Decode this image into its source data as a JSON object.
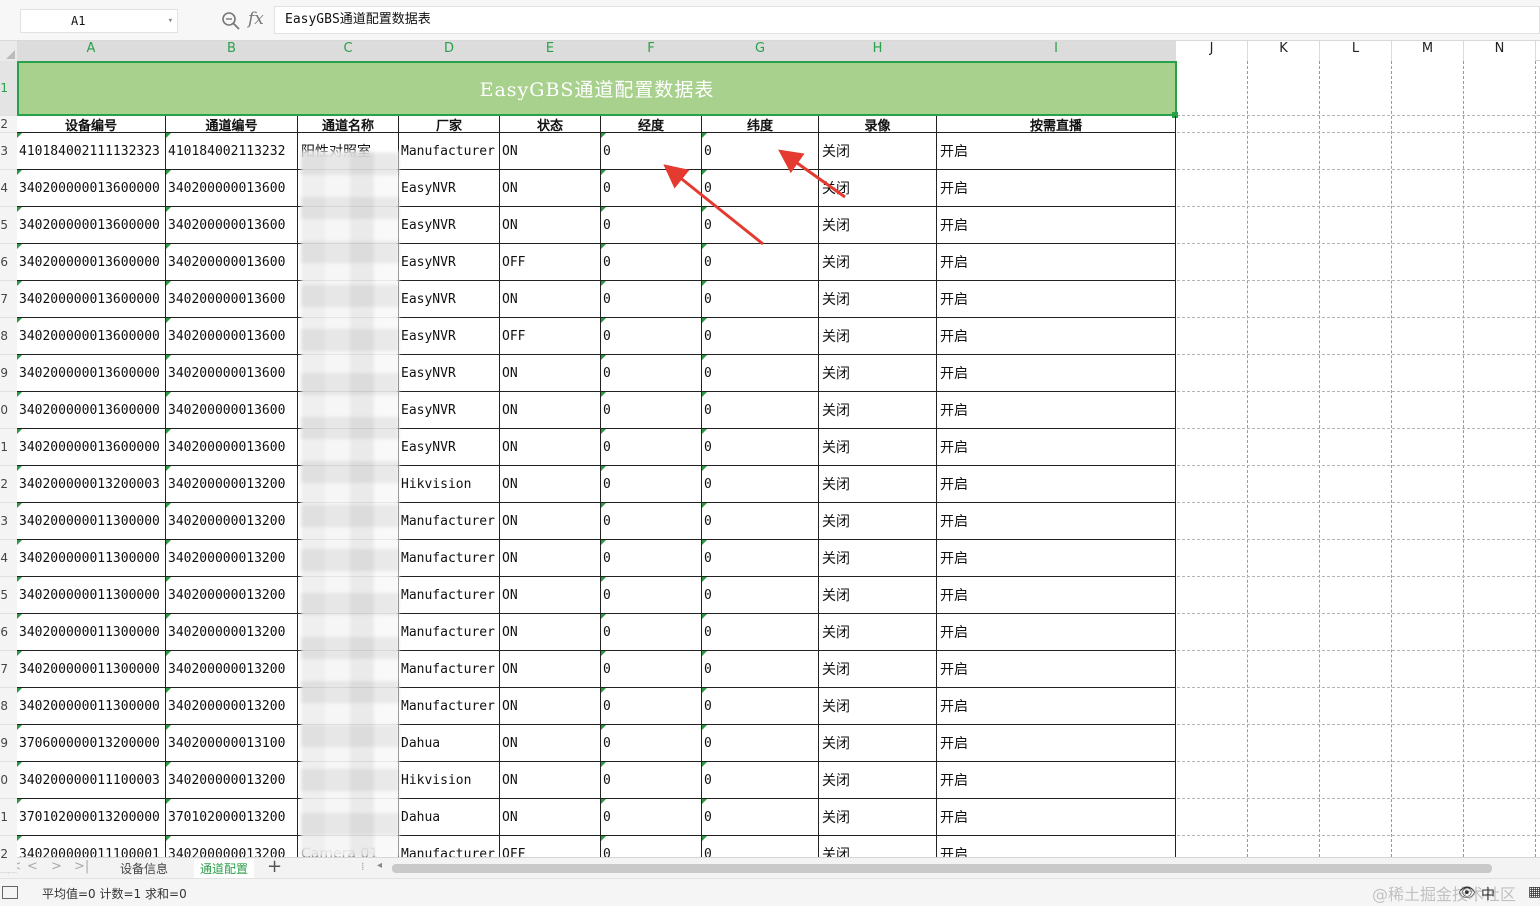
{
  "formula_bar": {
    "cell_ref": "A1",
    "fx_label": "fx",
    "content": "EasyGBS通道配置数据表"
  },
  "columns": [
    "A",
    "B",
    "C",
    "D",
    "E",
    "F",
    "G",
    "H",
    "I",
    "J",
    "K",
    "L",
    "M",
    "N"
  ],
  "row_numbers": [
    "1",
    "2",
    "3",
    "4",
    "5",
    "6",
    "7",
    "8",
    "9",
    "0",
    "1",
    "2",
    "3",
    "4",
    "5",
    "6",
    "7",
    "8",
    "9",
    "0",
    "1",
    "2"
  ],
  "sheet": {
    "title": "EasyGBS通道配置数据表",
    "headers": [
      "设备编号",
      "通道编号",
      "通道名称",
      "厂家",
      "状态",
      "经度",
      "纬度",
      "录像",
      "按需直播"
    ],
    "rows": [
      [
        "410184002111132323",
        "410184002113232",
        "阳性对照室",
        "Manufacturer",
        "ON",
        "0",
        "0",
        "关闭",
        "开启"
      ],
      [
        "340200000013600000",
        "340200000013600",
        "",
        "EasyNVR",
        "ON",
        "0",
        "0",
        "关闭",
        "开启"
      ],
      [
        "340200000013600000",
        "340200000013600",
        "",
        "EasyNVR",
        "ON",
        "0",
        "0",
        "关闭",
        "开启"
      ],
      [
        "340200000013600000",
        "340200000013600",
        "",
        "EasyNVR",
        "OFF",
        "0",
        "0",
        "关闭",
        "开启"
      ],
      [
        "340200000013600000",
        "340200000013600",
        "",
        "EasyNVR",
        "ON",
        "0",
        "0",
        "关闭",
        "开启"
      ],
      [
        "340200000013600000",
        "340200000013600",
        "",
        "EasyNVR",
        "OFF",
        "0",
        "0",
        "关闭",
        "开启"
      ],
      [
        "340200000013600000",
        "340200000013600",
        "",
        "EasyNVR",
        "ON",
        "0",
        "0",
        "关闭",
        "开启"
      ],
      [
        "340200000013600000",
        "340200000013600",
        "",
        "EasyNVR",
        "ON",
        "0",
        "0",
        "关闭",
        "开启"
      ],
      [
        "340200000013600000",
        "340200000013600",
        "",
        "EasyNVR",
        "ON",
        "0",
        "0",
        "关闭",
        "开启"
      ],
      [
        "340200000013200003",
        "340200000013200",
        "",
        "Hikvision",
        "ON",
        "0",
        "0",
        "关闭",
        "开启"
      ],
      [
        "340200000011300000",
        "340200000013200",
        "",
        "Manufacturer",
        "ON",
        "0",
        "0",
        "关闭",
        "开启"
      ],
      [
        "340200000011300000",
        "340200000013200",
        "",
        "Manufacturer",
        "ON",
        "0",
        "0",
        "关闭",
        "开启"
      ],
      [
        "340200000011300000",
        "340200000013200",
        "",
        "Manufacturer",
        "ON",
        "0",
        "0",
        "关闭",
        "开启"
      ],
      [
        "340200000011300000",
        "340200000013200",
        "",
        "Manufacturer",
        "ON",
        "0",
        "0",
        "关闭",
        "开启"
      ],
      [
        "340200000011300000",
        "340200000013200",
        "",
        "Manufacturer",
        "ON",
        "0",
        "0",
        "关闭",
        "开启"
      ],
      [
        "340200000011300000",
        "340200000013200",
        "",
        "Manufacturer",
        "ON",
        "0",
        "0",
        "关闭",
        "开启"
      ],
      [
        "370600000013200000",
        "340200000013100",
        "",
        "Dahua",
        "ON",
        "0",
        "0",
        "关闭",
        "开启"
      ],
      [
        "340200000011100003",
        "340200000013200",
        "",
        "Hikvision",
        "ON",
        "0",
        "0",
        "关闭",
        "开启"
      ],
      [
        "370102000013200000",
        "370102000013200",
        "",
        "Dahua",
        "ON",
        "0",
        "0",
        "关闭",
        "开启"
      ],
      [
        "340200000011100001",
        "340200000013200",
        "Camera 01",
        "Manufacturer",
        "OFF",
        "0",
        "0",
        "关闭",
        "开启"
      ]
    ]
  },
  "sheet_tabs": [
    "设备信息",
    "通道配置"
  ],
  "active_tab_index": 1,
  "status": {
    "text": "平均值=0  计数=1  求和=0",
    "watermark": "@稀土掘金技术社区",
    "lang": "中"
  },
  "colors": {
    "title_fill": "#a9d18e",
    "selection": "#27a14a",
    "annotation_arrow": "#e53a30"
  }
}
